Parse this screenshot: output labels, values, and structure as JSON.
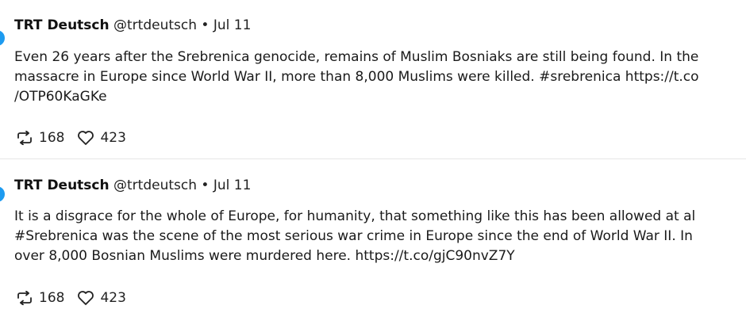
{
  "tweets": [
    {
      "author": "TRT Deutsch",
      "handle": "@trtdeutsch",
      "separator": "•",
      "date": "Jul 11",
      "lines": [
        "Even 26 years after the Srebrenica genocide, remains of Muslim Bosniaks are still being found. In the",
        "massacre in Europe since World War II, more than 8,000 Muslims were killed. #srebrenica https://t.co",
        "/OTP60KaGKe"
      ],
      "retweets": "168",
      "likes": "423"
    },
    {
      "author": "TRT Deutsch",
      "handle": "@trtdeutsch",
      "separator": "•",
      "date": "Jul 11",
      "lines": [
        "It is a disgrace for the whole of Europe, for humanity, that something like this has been allowed at al",
        "#Srebrenica was the scene of the most serious war crime in Europe since the end of World War II. In",
        "over 8,000 Bosnian Muslims were murdered here. https://t.co/gjC90nvZ7Y"
      ],
      "retweets": "168",
      "likes": "423"
    }
  ],
  "icons": {
    "retweet": "retweet-icon",
    "like": "heart-icon"
  },
  "colors": {
    "avatar": "#1d9bf0",
    "divider": "#e6e6e6"
  }
}
